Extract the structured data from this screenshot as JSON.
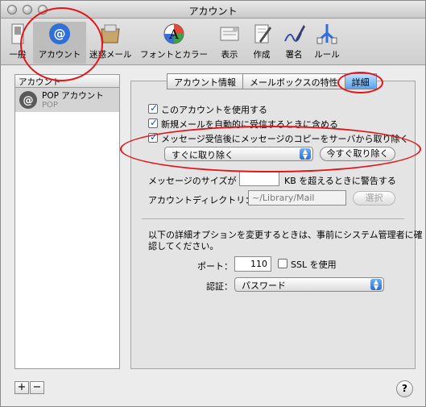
{
  "window": {
    "title": "アカウント"
  },
  "toolbar": {
    "items": [
      {
        "label": "一般",
        "icon": "switch-icon"
      },
      {
        "label": "アカウント",
        "icon": "at-icon"
      },
      {
        "label": "迷惑メール",
        "icon": "junk-mail-icon"
      },
      {
        "label": "フォントとカラー",
        "icon": "fonts-colors-icon"
      },
      {
        "label": "表示",
        "icon": "viewing-icon"
      },
      {
        "label": "作成",
        "icon": "composing-icon"
      },
      {
        "label": "署名",
        "icon": "signature-icon"
      },
      {
        "label": "ルール",
        "icon": "rules-icon"
      }
    ],
    "active": "アカウント"
  },
  "sidebar": {
    "header": "アカウント",
    "accounts": [
      {
        "name": "POP アカウント",
        "type": "POP"
      }
    ],
    "add_label": "+",
    "remove_label": "−"
  },
  "tabs": [
    "アカウント情報",
    "メールボックスの特性",
    "詳細"
  ],
  "active_tab": "詳細",
  "advanced": {
    "enable_label": "このアカウントを使用する",
    "enable_checked": true,
    "auto_check_label": "新規メールを自動的に受信するときに含める",
    "auto_check_checked": true,
    "remove_copy_label": "メッセージ受信後にメッセージのコピーをサーバから取り除く",
    "remove_copy_checked": true,
    "remove_timing_value": "すぐに取り除く",
    "remove_now_button": "今すぐ取り除く",
    "size_warn_prefix": "メッセージのサイズが",
    "size_warn_value": "",
    "size_warn_suffix": "KB を超えるときに警告する",
    "dir_label": "アカウントディレクトリ：",
    "dir_value": "~/Library/Mail",
    "dir_button": "選択",
    "admin_note_1": "以下の詳細オプションを変更するときは、事前にシステム管理者に確",
    "admin_note_2": "認してください。",
    "port_label": "ポート：",
    "port_value": "110",
    "ssl_label": "SSL を使用",
    "ssl_checked": false,
    "auth_label": "認証：",
    "auth_value": "パスワード"
  },
  "help_label": "?",
  "colors": {
    "accent": "#3b82e0",
    "annotation": "#e0161b"
  }
}
